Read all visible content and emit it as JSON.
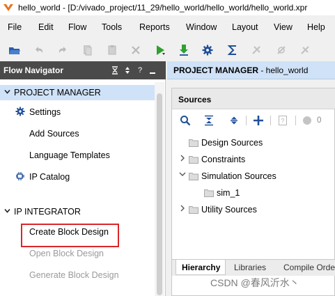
{
  "window": {
    "title": "hello_world - [D:/vivado_project/11_29/hello_world/hello_world/hello_world.xpr"
  },
  "menu": [
    "File",
    "Edit",
    "Flow",
    "Tools",
    "Reports",
    "Window",
    "Layout",
    "View",
    "Help"
  ],
  "toolbar": {
    "icons": [
      "open-project-icon",
      "undo-icon",
      "redo-icon",
      "copy-icon",
      "paste-icon",
      "delete-icon",
      "run-icon",
      "program-icon",
      "settings-icon",
      "sigma-icon",
      "disabled-tool-icon-1",
      "disabled-tool-icon-2",
      "disabled-tool-icon-3"
    ]
  },
  "flow_navigator": {
    "title": "Flow Navigator",
    "header_icons": [
      "collapse-all-icon",
      "expand-icon",
      "help-icon",
      "minimize-icon"
    ],
    "project_manager": {
      "label": "PROJECT MANAGER",
      "items": [
        {
          "label": "Settings",
          "icon": "gear-icon"
        },
        {
          "label": "Add Sources"
        },
        {
          "label": "Language Templates"
        },
        {
          "label": "IP Catalog",
          "icon": "ip-catalog-icon"
        }
      ]
    },
    "ip_integrator": {
      "label": "IP INTEGRATOR",
      "items": [
        {
          "label": "Create Block Design",
          "enabled": true
        },
        {
          "label": "Open Block Design",
          "enabled": false
        },
        {
          "label": "Generate Block Design",
          "enabled": false
        }
      ]
    }
  },
  "project_manager_panel": {
    "title_bold": "PROJECT MANAGER",
    "title_rest": " - hello_world"
  },
  "sources": {
    "title": "Sources",
    "count": "0",
    "tree": [
      {
        "label": "Design Sources",
        "expandable": false
      },
      {
        "label": "Constraints",
        "expandable": true
      },
      {
        "label": "Simulation Sources",
        "expandable": true,
        "expanded": true
      },
      {
        "label": "sim_1",
        "child": true
      },
      {
        "label": "Utility Sources",
        "expandable": true
      }
    ],
    "tabs": [
      "Hierarchy",
      "Libraries",
      "Compile Orde"
    ]
  },
  "watermark": "CSDN @春风沂水丶",
  "colors": {
    "nav_header": "#4a4a4a",
    "selection": "#cfe2f7",
    "highlight": "#d9262a",
    "run_green": "#2fa12f"
  }
}
